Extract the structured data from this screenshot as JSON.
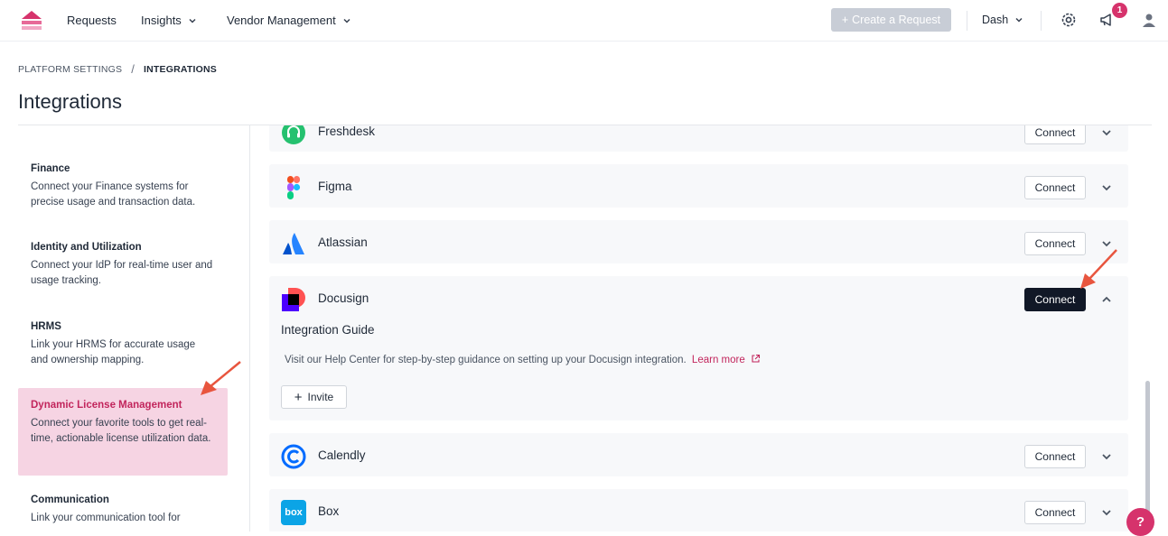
{
  "nav": {
    "items": [
      {
        "label": "Requests"
      },
      {
        "label": "Insights"
      },
      {
        "label": "Vendor Management"
      }
    ],
    "create_label": "Create a Request",
    "user_label": "Dash",
    "notification_count": "1"
  },
  "breadcrumb": {
    "parent": "PLATFORM SETTINGS",
    "separator": "/",
    "current": "INTEGRATIONS"
  },
  "page_title": "Integrations",
  "sidebar": {
    "categories": [
      {
        "title": "Finance",
        "desc": "Connect your Finance systems for precise usage and transaction data."
      },
      {
        "title": "Identity and Utilization",
        "desc": "Connect your IdP for real-time user and usage tracking."
      },
      {
        "title": "HRMS",
        "desc": "Link your HRMS for accurate usage and ownership mapping."
      },
      {
        "title": "Dynamic License Management",
        "desc": "Connect your favorite tools to get real-time, actionable license utilization data."
      },
      {
        "title": "Communication",
        "desc": "Link your communication tool for"
      }
    ]
  },
  "integrations": [
    {
      "name": "Freshdesk",
      "button": "Connect",
      "icon": "freshdesk-icon"
    },
    {
      "name": "Figma",
      "button": "Connect",
      "icon": "figma-icon"
    },
    {
      "name": "Atlassian",
      "button": "Connect",
      "icon": "atlassian-icon"
    },
    {
      "name": "Docusign",
      "button": "Connect",
      "icon": "docusign-icon",
      "guide_title": "Integration Guide",
      "guide_text": "Visit our Help Center for step-by-step guidance on setting up your Docusign integration.",
      "learn_more": "Learn more",
      "invite_label": "Invite"
    },
    {
      "name": "Calendly",
      "button": "Connect",
      "icon": "calendly-icon"
    },
    {
      "name": "Box",
      "button": "Connect",
      "icon": "box-icon",
      "icon_text": "box"
    }
  ],
  "help_label": "?",
  "colors": {
    "accent": "#d6336c",
    "active_bg": "#f6d4e3",
    "dark_button": "#111827"
  }
}
